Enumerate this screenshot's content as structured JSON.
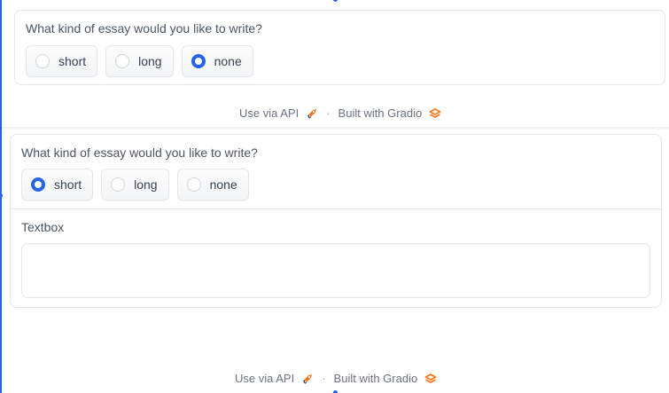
{
  "top_app": {
    "radio_group": {
      "label": "What kind of essay would you like to write?",
      "options": [
        "short",
        "long",
        "none"
      ],
      "selected": "none"
    },
    "footer": {
      "use_via_api": "Use via API",
      "separator": "·",
      "built_with": "Built with Gradio"
    }
  },
  "bottom_app": {
    "radio_group": {
      "label": "What kind of essay would you like to write?",
      "options": [
        "short",
        "long",
        "none"
      ],
      "selected": "short"
    },
    "textbox": {
      "label": "Textbox",
      "value": "",
      "placeholder": ""
    },
    "footer": {
      "use_via_api": "Use via API",
      "separator": "·",
      "built_with": "Built with Gradio"
    }
  },
  "colors": {
    "accent": "#2563eb",
    "gradio_logo": "#f97316",
    "border": "#e5e7eb",
    "text_muted": "#6b7280"
  },
  "icons": [
    "rocket-icon",
    "gradio-logo-icon"
  ]
}
